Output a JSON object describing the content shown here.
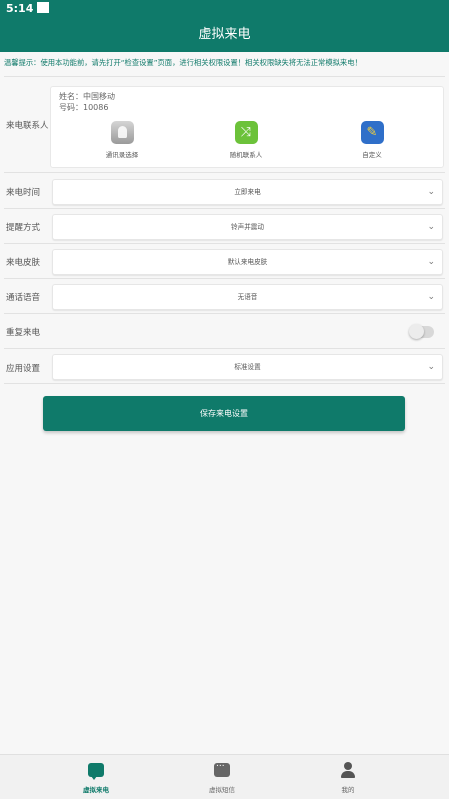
{
  "status_bar": {
    "time": "5:14"
  },
  "app_bar": {
    "title": "虚拟来电"
  },
  "tip": "温馨提示：使用本功能前，请先打开“检查设置”页面，进行相关权限设置！相关权限缺失将无法正常模拟来电！",
  "contact": {
    "label": "来电联系人",
    "name_line": "姓名：中国移动",
    "number_line": "号码：10086",
    "options": [
      {
        "label": "通讯录选择",
        "icon": "contacts-icon"
      },
      {
        "label": "随机联系人",
        "icon": "shuffle-icon"
      },
      {
        "label": "自定义",
        "icon": "edit-icon"
      }
    ]
  },
  "settings": [
    {
      "label": "来电时间",
      "value": "立即来电"
    },
    {
      "label": "提醒方式",
      "value": "铃声并震动"
    },
    {
      "label": "来电皮肤",
      "value": "默认来电皮肤"
    },
    {
      "label": "通话语音",
      "value": "无语音"
    }
  ],
  "repeat": {
    "label": "重复来电",
    "enabled": false
  },
  "app_settings": {
    "label": "应用设置",
    "value": "标准设置"
  },
  "save_button": "保存来电设置",
  "bottom_nav": [
    {
      "label": "虚拟来电",
      "active": true,
      "icon": "call-chat-icon"
    },
    {
      "label": "虚拟短信",
      "active": false,
      "icon": "message-icon"
    },
    {
      "label": "我的",
      "active": false,
      "icon": "person-icon"
    }
  ],
  "colors": {
    "primary": "#0f7a6a",
    "background": "#f7f7f7"
  }
}
